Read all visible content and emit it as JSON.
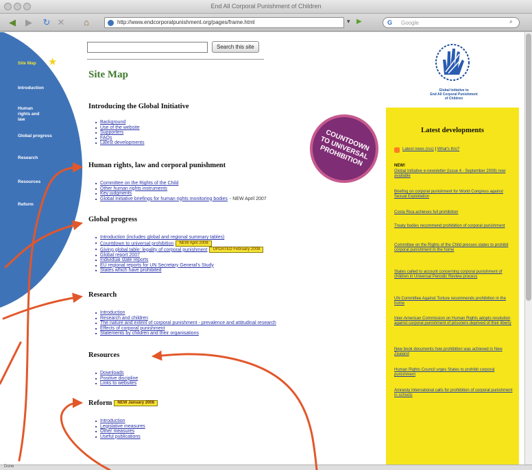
{
  "window": {
    "title": "End All Corporal Punishment of Children"
  },
  "toolbar": {
    "url": "http://www.endcorporalpunishment.org/pages/frame.html",
    "search_placeholder": "Google"
  },
  "status": {
    "text": "Done"
  },
  "nav": {
    "items": [
      {
        "label": "Site Map",
        "active": true
      },
      {
        "label": "Introduction"
      },
      {
        "label": "Human rights and law"
      },
      {
        "label": "Global progress"
      },
      {
        "label": "Research"
      },
      {
        "label": "Resources"
      },
      {
        "label": "Reform"
      }
    ]
  },
  "site_search": {
    "button_label": "Search this site"
  },
  "page": {
    "title": "Site Map"
  },
  "sections": {
    "intro": {
      "title": "Introducing the Global Initiative",
      "links": [
        "Background",
        "Use of the website",
        "Supporters",
        "FAQs",
        "Latest developments"
      ]
    },
    "human_rights": {
      "title": "Human rights, law and corporal punishment",
      "links": [
        "Committee on the Rights of the Child",
        "Other human rights instruments",
        "Key judgments",
        "Global Initiative briefings for human rights monitoring bodies"
      ],
      "note": "- NEW April 2007"
    },
    "global_progress": {
      "title": "Global progress",
      "links": [
        "Introduction (includes global and regional summary tables)",
        "Countdown to universal prohibition",
        "Giving global table: legality of corporal punishment",
        "Global report 2007",
        "Individual state reports",
        "EU regional reports for UN Secretary General's Study",
        "States which have prohibited"
      ],
      "tag_countdown": "NEW April 2008",
      "tag_table": "UPDATED February 2008"
    },
    "research": {
      "title": "Research",
      "links": [
        "Introduction",
        "Research and children",
        "The nature and extent of corporal punishment - prevalence and attitudinal research",
        "Effects of corporal punishment",
        "Statements by children and their organisations"
      ]
    },
    "resources": {
      "title": "Resources",
      "links": [
        "Downloads",
        "Positive discipline",
        "Links to websites"
      ]
    },
    "reform": {
      "title": "Reform",
      "tag": "NEW January 2008",
      "links": [
        "Introduction",
        "Legislative measures",
        "Other measures",
        "Useful publications"
      ]
    }
  },
  "countdown": {
    "line1": "COUNTDOWN",
    "line2": "TO UNIVERSAL",
    "line3": "PROHIBITION"
  },
  "logo": {
    "line1": "Global Initiative to",
    "line2": "End All Corporal Punishment",
    "line3": "of Children"
  },
  "latest": {
    "title": "Latest developments",
    "rss_label": "Latest news (rss)",
    "rss_sep": " | ",
    "rss_help": "What's this?",
    "new_label": "NEW!",
    "items": [
      "Global Initiative e-newsletter (issue 4 - September 2008) now available",
      "Briefing on corporal punishment for World Congress against Sexual Exploitation",
      "Costa Rica achieves full prohibition",
      "Treaty bodies recommend prohibition of corporal punishment",
      "Committee on the Rights of the Child presses states to prohibit corporal punishment in the home",
      "States called to account concerning corporal punishment of children in Universal Periodic Review process",
      "UN Committee Against Torture recommends prohibition in the home",
      "Inter-American Commission on Human Rights adopts resolution against corporal punishment of prisoners deprived of their liberty",
      "New book documents how prohibition was achieved in New Zealand",
      "Human Rights Council urges States to prohibit corporal punishment",
      "Amnesty International calls for prohibition of corporal punishment in schools"
    ]
  },
  "colors": {
    "nav_blue": "#3f73b8",
    "title_green": "#3f7a2f",
    "link_blue": "#2a34a8",
    "sidebar_yellow": "#f6e51a",
    "arrow_orange": "#e2572a",
    "badge_purple": "#7f2d74"
  }
}
